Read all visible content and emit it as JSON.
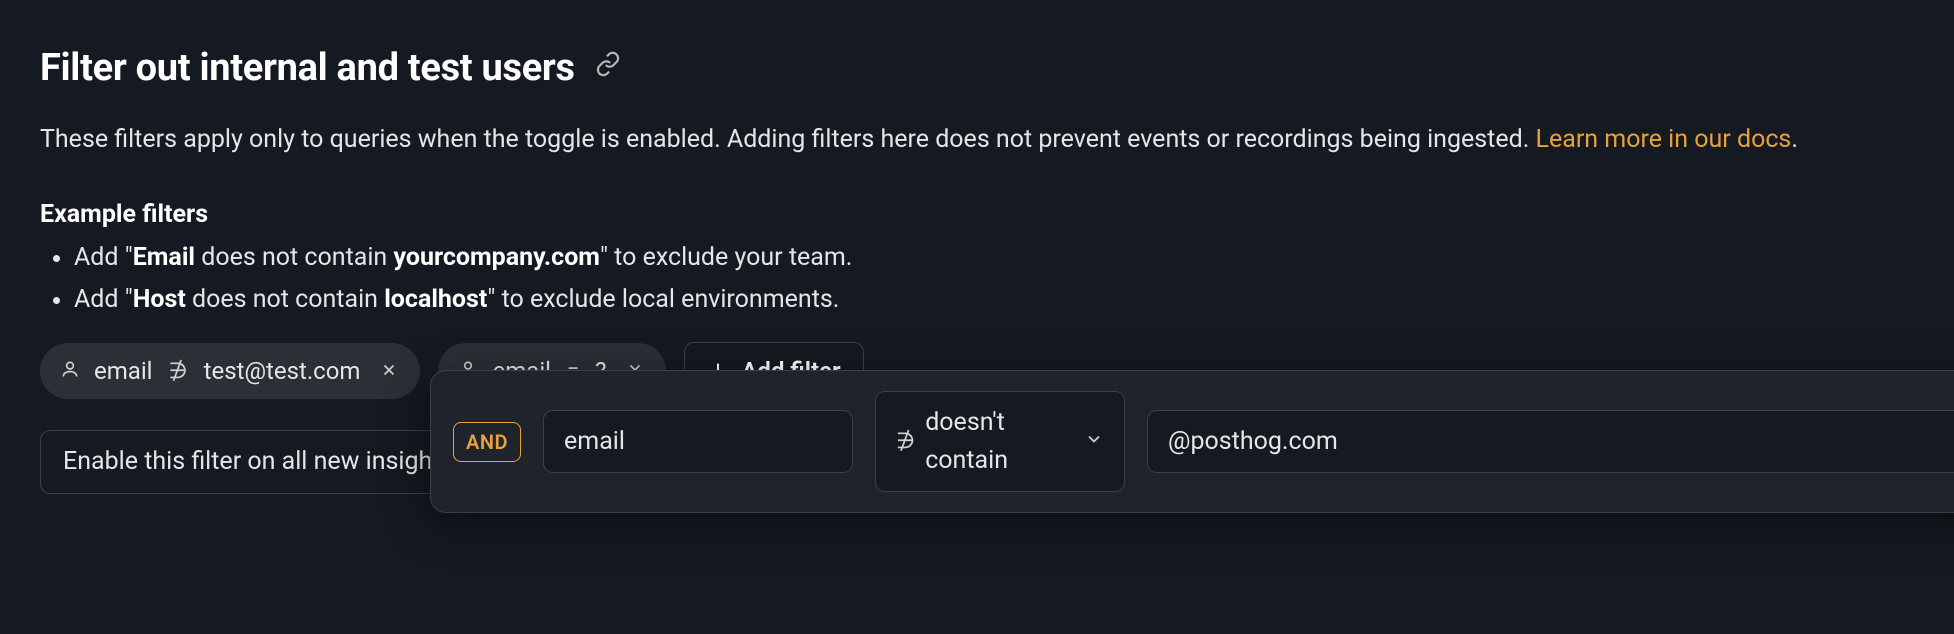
{
  "heading": "Filter out internal and test users",
  "description": {
    "text": "These filters apply only to queries when the toggle is enabled. Adding filters here does not prevent events or recordings being ingested. ",
    "link": "Learn more in our docs",
    "period": "."
  },
  "examples": {
    "title": "Example filters",
    "items": [
      {
        "prefix": "Add \"",
        "bold1": "Email",
        "mid": " does not contain ",
        "bold2": "yourcompany.com",
        "suffix": "\" to exclude your team."
      },
      {
        "prefix": "Add \"",
        "bold1": "Host",
        "mid": " does not contain ",
        "bold2": "localhost",
        "suffix": "\" to exclude local environments."
      }
    ]
  },
  "chips": [
    {
      "field": "email",
      "op_glyph": "∌",
      "value": "test@test.com"
    },
    {
      "field": "email",
      "op_glyph": "=",
      "value": "?"
    }
  ],
  "add_filter_label": "Add filter",
  "enable_label": "Enable this filter on all new insight",
  "builder": {
    "conjunction": "AND",
    "property": "email",
    "operator": {
      "glyph": "∌",
      "label": "doesn't contain"
    },
    "value": "@posthog.com"
  }
}
